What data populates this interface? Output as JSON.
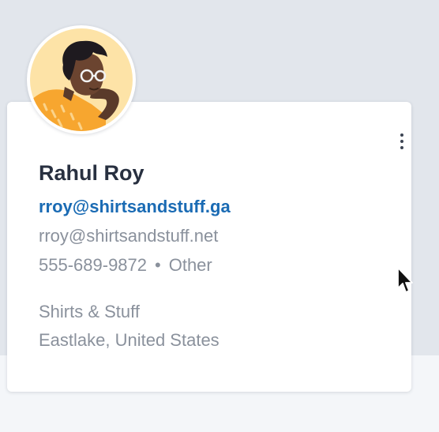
{
  "contact": {
    "name": "Rahul Roy",
    "primary_email": "rroy@shirtsandstuff.ga",
    "secondary_email": "rroy@shirtsandstuff.net",
    "phone": "555-689-9872",
    "separator": "•",
    "phone_type": "Other",
    "company": "Shirts & Stuff",
    "location": "Eastlake, United States"
  },
  "icons": {
    "menu": "more-vertical-icon",
    "cursor": "mouse-pointer-icon"
  },
  "colors": {
    "name": "#283040",
    "link": "#1a6bb4",
    "secondary_text": "#8a919c",
    "card_background": "#ffffff",
    "page_background": "#e2e6ec",
    "avatar_background": "#fde3a7",
    "shirt": "#f7a62f"
  }
}
